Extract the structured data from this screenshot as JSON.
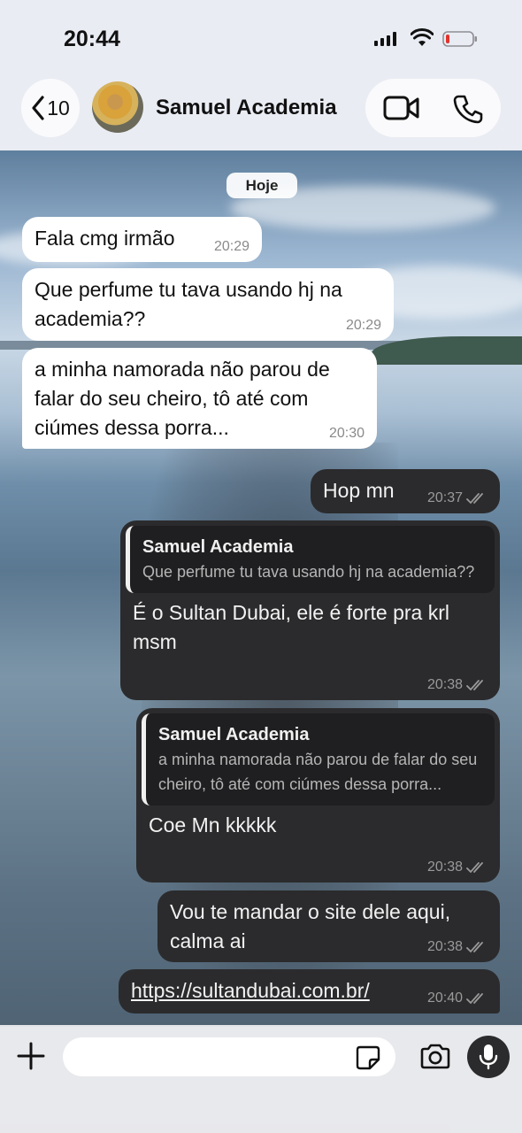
{
  "status_bar": {
    "time": "20:44"
  },
  "header": {
    "back_count": "10",
    "contact_name": "Samuel Academia"
  },
  "chat": {
    "date_label": "Hoje",
    "messages": [
      {
        "direction": "in",
        "text": "Fala cmg irmão",
        "time": "20:29"
      },
      {
        "direction": "in",
        "text": "Que perfume tu tava usando hj na academia??",
        "time": "20:29"
      },
      {
        "direction": "in",
        "text": "a minha namorada não parou de falar do seu cheiro, tô até com ciúmes dessa porra...",
        "time": "20:30"
      },
      {
        "direction": "out",
        "text": "Hop mn",
        "time": "20:37"
      },
      {
        "direction": "out",
        "reply_to_name": "Samuel Academia",
        "reply_to_text": "Que perfume tu tava usando hj na academia??",
        "text": "É o Sultan Dubai, ele é forte pra krl msm",
        "time": "20:38"
      },
      {
        "direction": "out",
        "reply_to_name": "Samuel Academia",
        "reply_to_text": "a minha namorada não parou de falar do seu cheiro, tô até com ciúmes dessa porra...",
        "text": "Coe Mn kkkkk",
        "time": "20:38"
      },
      {
        "direction": "out",
        "text": "Vou te mandar o site dele aqui, calma ai",
        "time": "20:38"
      },
      {
        "direction": "out",
        "text": "https://sultandubai.com.br/",
        "time": "20:40"
      }
    ]
  },
  "input": {
    "placeholder": ""
  },
  "colors": {
    "outgoing_bubble": "#2b2b2d",
    "incoming_bubble": "#ffffff",
    "header_bg": "#ebeef4"
  }
}
